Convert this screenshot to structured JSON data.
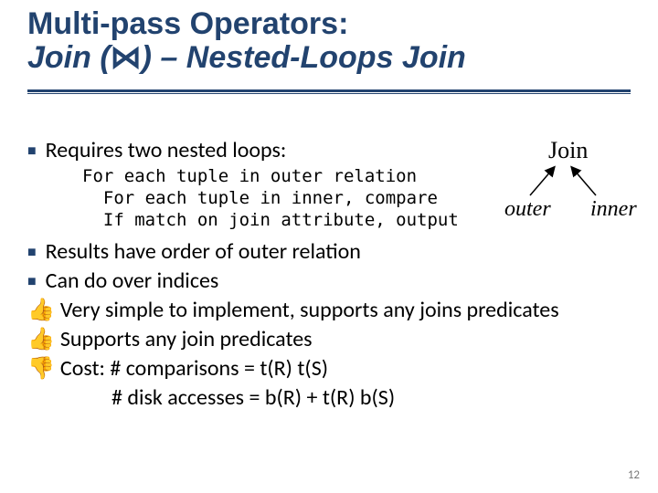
{
  "title": {
    "line1": "Multi-pass Operators:",
    "line2_prefix": "Join  (",
    "line2_symbol": "⋈",
    "line2_suffix": ") – Nested-Loops Join"
  },
  "bullets": {
    "b1": "Requires two nested loops:",
    "code": "For each tuple in outer relation\n  For each tuple in inner, compare\n  If match on join attribute, output",
    "b2": "Results have order of outer relation",
    "b3": "Can do over indices",
    "b4": "Very simple to implement, supports any joins predicates",
    "b5": "Supports any join predicates",
    "b6": "Cost:  # comparisons = t(R) t(S)",
    "b6b": "# disk accesses = b(R) + t(R) b(S)"
  },
  "diagram": {
    "top": "Join",
    "left": "outer",
    "right": "inner"
  },
  "icons": {
    "square": "■",
    "thumbs_up": "👍",
    "thumbs_down": "👎"
  },
  "page_number": "12"
}
